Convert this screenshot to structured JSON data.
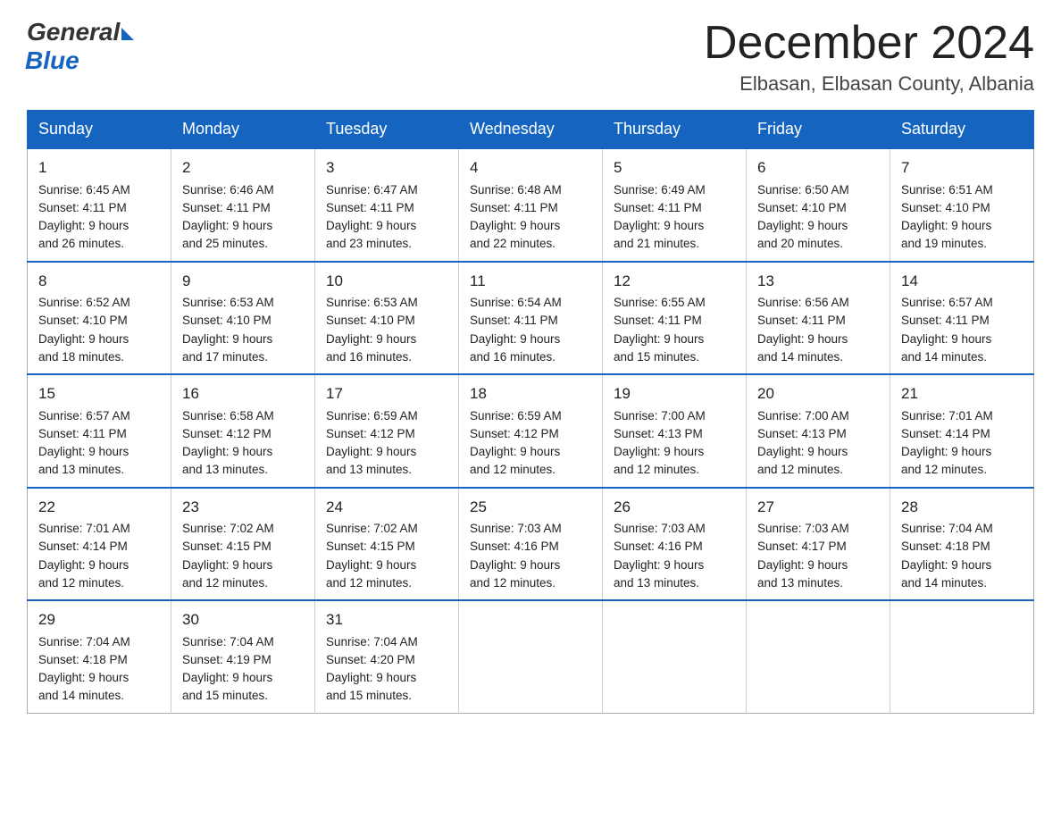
{
  "logo": {
    "general": "General",
    "blue": "Blue"
  },
  "title": "December 2024",
  "location": "Elbasan, Elbasan County, Albania",
  "headers": [
    "Sunday",
    "Monday",
    "Tuesday",
    "Wednesday",
    "Thursday",
    "Friday",
    "Saturday"
  ],
  "weeks": [
    [
      {
        "day": "1",
        "info": "Sunrise: 6:45 AM\nSunset: 4:11 PM\nDaylight: 9 hours\nand 26 minutes."
      },
      {
        "day": "2",
        "info": "Sunrise: 6:46 AM\nSunset: 4:11 PM\nDaylight: 9 hours\nand 25 minutes."
      },
      {
        "day": "3",
        "info": "Sunrise: 6:47 AM\nSunset: 4:11 PM\nDaylight: 9 hours\nand 23 minutes."
      },
      {
        "day": "4",
        "info": "Sunrise: 6:48 AM\nSunset: 4:11 PM\nDaylight: 9 hours\nand 22 minutes."
      },
      {
        "day": "5",
        "info": "Sunrise: 6:49 AM\nSunset: 4:11 PM\nDaylight: 9 hours\nand 21 minutes."
      },
      {
        "day": "6",
        "info": "Sunrise: 6:50 AM\nSunset: 4:10 PM\nDaylight: 9 hours\nand 20 minutes."
      },
      {
        "day": "7",
        "info": "Sunrise: 6:51 AM\nSunset: 4:10 PM\nDaylight: 9 hours\nand 19 minutes."
      }
    ],
    [
      {
        "day": "8",
        "info": "Sunrise: 6:52 AM\nSunset: 4:10 PM\nDaylight: 9 hours\nand 18 minutes."
      },
      {
        "day": "9",
        "info": "Sunrise: 6:53 AM\nSunset: 4:10 PM\nDaylight: 9 hours\nand 17 minutes."
      },
      {
        "day": "10",
        "info": "Sunrise: 6:53 AM\nSunset: 4:10 PM\nDaylight: 9 hours\nand 16 minutes."
      },
      {
        "day": "11",
        "info": "Sunrise: 6:54 AM\nSunset: 4:11 PM\nDaylight: 9 hours\nand 16 minutes."
      },
      {
        "day": "12",
        "info": "Sunrise: 6:55 AM\nSunset: 4:11 PM\nDaylight: 9 hours\nand 15 minutes."
      },
      {
        "day": "13",
        "info": "Sunrise: 6:56 AM\nSunset: 4:11 PM\nDaylight: 9 hours\nand 14 minutes."
      },
      {
        "day": "14",
        "info": "Sunrise: 6:57 AM\nSunset: 4:11 PM\nDaylight: 9 hours\nand 14 minutes."
      }
    ],
    [
      {
        "day": "15",
        "info": "Sunrise: 6:57 AM\nSunset: 4:11 PM\nDaylight: 9 hours\nand 13 minutes."
      },
      {
        "day": "16",
        "info": "Sunrise: 6:58 AM\nSunset: 4:12 PM\nDaylight: 9 hours\nand 13 minutes."
      },
      {
        "day": "17",
        "info": "Sunrise: 6:59 AM\nSunset: 4:12 PM\nDaylight: 9 hours\nand 13 minutes."
      },
      {
        "day": "18",
        "info": "Sunrise: 6:59 AM\nSunset: 4:12 PM\nDaylight: 9 hours\nand 12 minutes."
      },
      {
        "day": "19",
        "info": "Sunrise: 7:00 AM\nSunset: 4:13 PM\nDaylight: 9 hours\nand 12 minutes."
      },
      {
        "day": "20",
        "info": "Sunrise: 7:00 AM\nSunset: 4:13 PM\nDaylight: 9 hours\nand 12 minutes."
      },
      {
        "day": "21",
        "info": "Sunrise: 7:01 AM\nSunset: 4:14 PM\nDaylight: 9 hours\nand 12 minutes."
      }
    ],
    [
      {
        "day": "22",
        "info": "Sunrise: 7:01 AM\nSunset: 4:14 PM\nDaylight: 9 hours\nand 12 minutes."
      },
      {
        "day": "23",
        "info": "Sunrise: 7:02 AM\nSunset: 4:15 PM\nDaylight: 9 hours\nand 12 minutes."
      },
      {
        "day": "24",
        "info": "Sunrise: 7:02 AM\nSunset: 4:15 PM\nDaylight: 9 hours\nand 12 minutes."
      },
      {
        "day": "25",
        "info": "Sunrise: 7:03 AM\nSunset: 4:16 PM\nDaylight: 9 hours\nand 12 minutes."
      },
      {
        "day": "26",
        "info": "Sunrise: 7:03 AM\nSunset: 4:16 PM\nDaylight: 9 hours\nand 13 minutes."
      },
      {
        "day": "27",
        "info": "Sunrise: 7:03 AM\nSunset: 4:17 PM\nDaylight: 9 hours\nand 13 minutes."
      },
      {
        "day": "28",
        "info": "Sunrise: 7:04 AM\nSunset: 4:18 PM\nDaylight: 9 hours\nand 14 minutes."
      }
    ],
    [
      {
        "day": "29",
        "info": "Sunrise: 7:04 AM\nSunset: 4:18 PM\nDaylight: 9 hours\nand 14 minutes."
      },
      {
        "day": "30",
        "info": "Sunrise: 7:04 AM\nSunset: 4:19 PM\nDaylight: 9 hours\nand 15 minutes."
      },
      {
        "day": "31",
        "info": "Sunrise: 7:04 AM\nSunset: 4:20 PM\nDaylight: 9 hours\nand 15 minutes."
      },
      {
        "day": "",
        "info": ""
      },
      {
        "day": "",
        "info": ""
      },
      {
        "day": "",
        "info": ""
      },
      {
        "day": "",
        "info": ""
      }
    ]
  ]
}
